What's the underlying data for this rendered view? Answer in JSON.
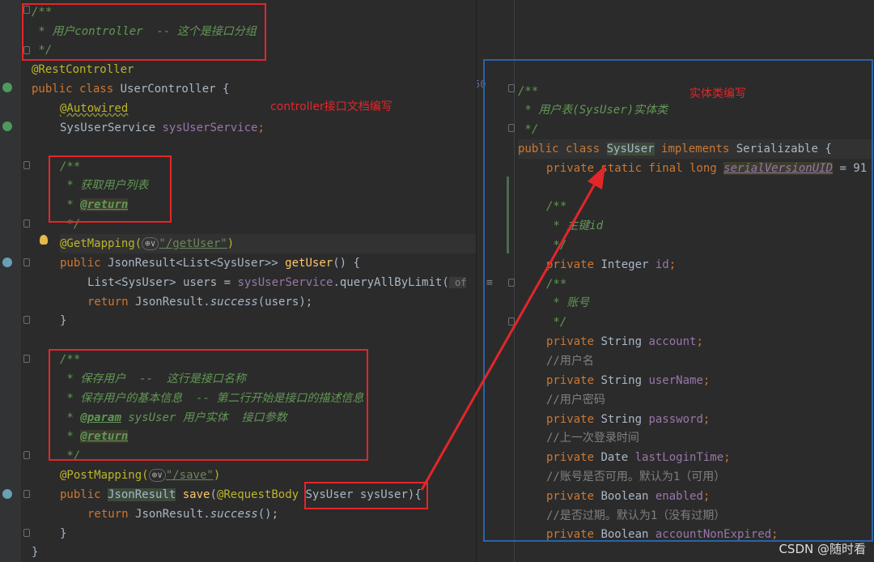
{
  "left_code": {
    "l1": "/**",
    "l2": " * 用户controller  -- 这个是接口分组",
    "l3": " */",
    "l4_ann": "@RestController",
    "l5_kw": "public class ",
    "l5_name": "UserController {",
    "l6_ann": "@Autowired",
    "l7_type": "SysUserService ",
    "l7_field": "sysUserService",
    "l7_end": ";",
    "l9": "/**",
    "l10": " * 获取用户列表",
    "l11_pre": " * ",
    "l11_tag": "@return",
    "l12": " */",
    "l13_ann": "@GetMapping(",
    "l13_chip": "⊕∨",
    "l13_str": "\"/getUser\"",
    "l13_end": ")",
    "l14_kw": "public ",
    "l14_type": "JsonResult<List<SysUser>> ",
    "l14_mth": "getUser",
    "l14_end": "() {",
    "l15_type": "List<SysUser> users = ",
    "l15_fld": "sysUserService",
    "l15_end": ".queryAllByLimit(",
    "l15_hint": " of",
    "l16_kw": "return ",
    "l16_cls": "JsonResult.",
    "l16_mth": "success",
    "l16_end": "(users);",
    "l17": "}",
    "l19": "/**",
    "l20": " * 保存用户  --  这行是接口名称",
    "l21": " * 保存用户的基本信息  -- 第二行开始是接口的描述信息",
    "l22_pre": " * ",
    "l22_tag": "@param",
    "l22_post": " sysUser 用户实体  接口参数",
    "l23_pre": " * ",
    "l23_tag": "@return",
    "l24": " */",
    "l25_ann": "@PostMapping(",
    "l25_chip": "⊕∨",
    "l25_str": "\"/save\"",
    "l25_end": ")",
    "l26_kw": "public ",
    "l26_type": "JsonResult",
    "l26_mth": " save",
    "l26_mid": "(",
    "l26_ann": "@RequestBody ",
    "l26_param": "SysUser sysUser",
    "l26_end": "){",
    "l27_kw": "return ",
    "l27_cls": "JsonResult.",
    "l27_mth": "success",
    "l27_end": "();",
    "l28": "}",
    "l29": "}"
  },
  "right_code": {
    "stray": "50",
    "r1": "/**",
    "r2": " * 用户表(SysUser)实体类",
    "r3": " */",
    "r4_kw": "public class ",
    "r4_name": "SysUser",
    "r4_kw2": " implements ",
    "r4_end": "Serializable {",
    "r5_kw": "private static final long ",
    "r5_fld": "serialVersionUID",
    "r5_end": " = 91",
    "r7": "/**",
    "r8": " * 主键id",
    "r9": " */",
    "r10_kw": "private ",
    "r10_type": "Integer ",
    "r10_fld": "id",
    "r10_end": ";",
    "r11": "/**",
    "r12": " * 账号",
    "r13": " */",
    "r14_kw": "private ",
    "r14_type": "String ",
    "r14_fld": "account",
    "r15": "//用户名",
    "r16_kw": "private ",
    "r16_type": "String ",
    "r16_fld": "userName",
    "r17": "//用户密码",
    "r18_kw": "private ",
    "r18_type": "String ",
    "r18_fld": "password",
    "r19": "//上一次登录时间",
    "r20_kw": "private ",
    "r20_type": "Date ",
    "r20_fld": "lastLoginTime",
    "r21": "//账号是否可用。默认为1（可用）",
    "r22_kw": "private ",
    "r22_type": "Boolean ",
    "r22_fld": "enabled",
    "r23": "//是否过期。默认为1（没有过期）",
    "r24_kw": "private ",
    "r24_type": "Boolean ",
    "r24_fld": "accountNonExpired",
    "semi": ";"
  },
  "notes": {
    "controller_doc": "controller接口文档编写",
    "entity_doc": "实体类编写"
  },
  "watermark": "CSDN @随时看",
  "colors": {
    "annotation_red": "#e3262a",
    "pane_border_blue": "#2b62a9",
    "editor_bg": "#2b2b2b"
  }
}
